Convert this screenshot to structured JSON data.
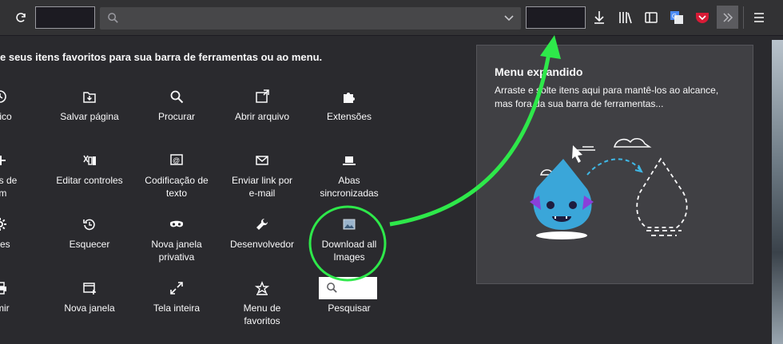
{
  "toolbar": {
    "reload_icon": "reload-icon",
    "dropdown_icon": "chevron-down-icon",
    "download_icon": "download-icon",
    "library_icon": "library-icon",
    "sidebar_icon": "sidebar-icon",
    "translate_icon": "translate-icon",
    "pocket_icon": "pocket-icon",
    "overflow_icon": "double-chevron-icon",
    "menu_icon": "hamburger-icon"
  },
  "customize": {
    "heading": "e seus itens favoritos para sua barra de ferramentas ou ao menu.",
    "items": [
      {
        "label": "tórico",
        "icon": "history-icon"
      },
      {
        "label": "Salvar página",
        "icon": "save-page-icon"
      },
      {
        "label": "Procurar",
        "icon": "search-icon"
      },
      {
        "label": "Abrir arquivo",
        "icon": "open-file-icon"
      },
      {
        "label": "Extensões",
        "icon": "puzzle-icon"
      },
      {
        "label": "roles de\nom",
        "icon": "zoom-icon"
      },
      {
        "label": "Editar controles",
        "icon": "edit-controls-icon"
      },
      {
        "label": "Codificação de\ntexto",
        "icon": "encoding-icon"
      },
      {
        "label": "Enviar link por\ne-mail",
        "icon": "email-icon"
      },
      {
        "label": "Abas\nsincronizadas",
        "icon": "synced-tabs-icon"
      },
      {
        "label": "ções",
        "icon": "gear-icon"
      },
      {
        "label": "Esquecer",
        "icon": "forget-icon"
      },
      {
        "label": "Nova janela\nprivativa",
        "icon": "private-window-icon"
      },
      {
        "label": "Desenvolvedor",
        "icon": "wrench-icon"
      },
      {
        "label": "Download all\nImages",
        "icon": "image-icon"
      },
      {
        "label": "rimir",
        "icon": "print-icon"
      },
      {
        "label": "Nova janela",
        "icon": "new-window-icon"
      },
      {
        "label": "Tela inteira",
        "icon": "fullscreen-icon"
      },
      {
        "label": "Menu de\nfavoritos",
        "icon": "bookmarks-menu-icon"
      },
      {
        "label": "Pesquisar",
        "icon": "search-icon"
      }
    ]
  },
  "overflow_menu": {
    "title": "Menu expandido",
    "description": "Arraste e solte itens aqui para mantê-los ao alcance, mas fora da sua barra de ferramentas..."
  },
  "annotation": {
    "color": "#2ee84a"
  }
}
